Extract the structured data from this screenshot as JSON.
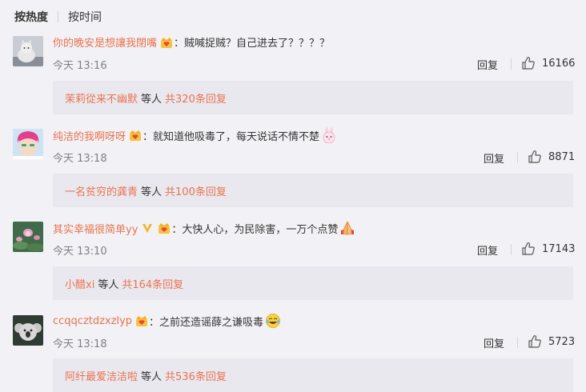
{
  "sort_tabs": {
    "hot": "按热度",
    "time": "按时间"
  },
  "labels": {
    "reply": "回复",
    "others": "等人"
  },
  "colors": {
    "accent": "#eb7350",
    "background": "#f2f1f5",
    "subbox": "#e9e8ee"
  },
  "comments": [
    {
      "username": "你的晚安是想讓我閉嘴",
      "badge": "gold-crown-heart-icon",
      "colon": "：",
      "text": "贼喊捉贼？自己进去了？？？？",
      "time": "今天 13:16",
      "likes": "16166",
      "sub_user": "茉莉從来不幽默",
      "sub_more": "共320条回复"
    },
    {
      "username": "纯洁的我啊呀呀",
      "badge": "gold-crown-heart-icon",
      "colon": "：",
      "text": "就知道他吸毒了，每天说话不情不楚",
      "emoji": "bunny-emoji-icon",
      "time": "今天 13:18",
      "likes": "8871",
      "sub_user": "一名贫穷的龚青",
      "sub_more": "共100条回复"
    },
    {
      "username": "其实幸福很简单yy",
      "vip_badge": "v-verified-icon",
      "badge": "gold-crown-heart-icon",
      "colon": "：",
      "text": "大快人心，为民除害，一万个点赞",
      "emoji": "praying-hands-emoji-icon",
      "time": "今天 13:10",
      "likes": "17143",
      "sub_user": "小醋xi",
      "sub_more": "共164条回复"
    },
    {
      "username": "ccqqcztdzxzlyp",
      "badge": "gold-crown-heart-icon",
      "colon": "：",
      "text": "之前还造谣薛之谦吸毒",
      "emoji": "laughing-tears-emoji-icon",
      "time": "今天 13:18",
      "likes": "5723",
      "sub_user": "阿纤最爱洁洁啦",
      "sub_more": "共536条回复"
    }
  ]
}
